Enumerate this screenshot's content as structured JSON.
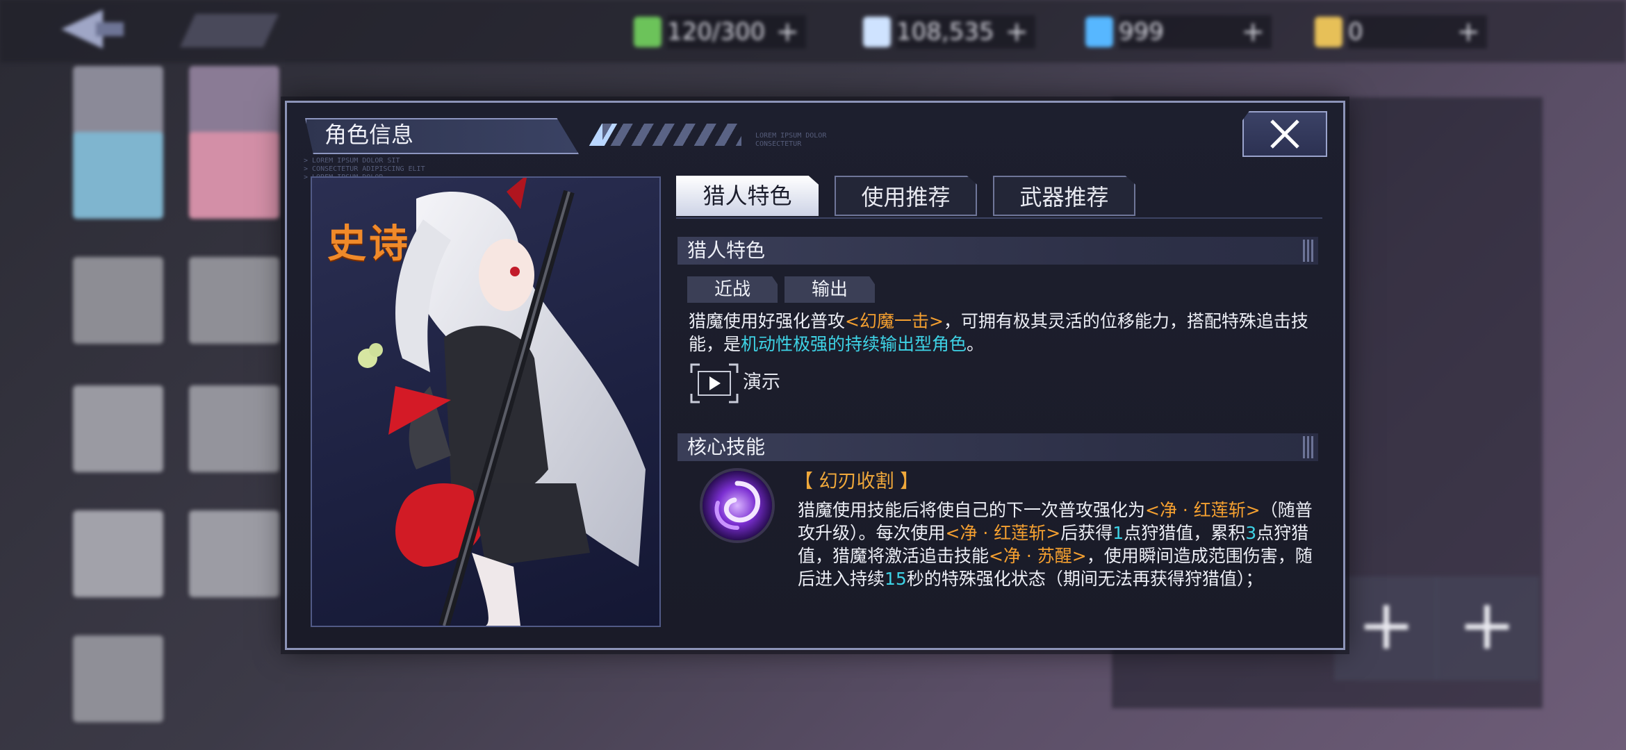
{
  "topbar": {
    "resources": [
      {
        "icon": "battery-icon",
        "value": "120/300",
        "color": "#6cc35a"
      },
      {
        "icon": "diamond-icon",
        "value": "108,535",
        "color": "#cfe3ff"
      },
      {
        "icon": "gem-icon",
        "value": "999",
        "color": "#57b7ff"
      },
      {
        "icon": "ticket-icon",
        "value": "0",
        "color": "#e7c058"
      }
    ]
  },
  "modal": {
    "title": "角色信息",
    "rarity": "史诗",
    "tiny_text_1": "LOREM IPSUM DOLOR\nCONSECTETUR",
    "tiny_text_2": "> LOREM IPSUM DOLOR SIT\n> CONSECTETUR ADIPISCING ELIT\n> LOREM IPSUM DOLOR",
    "tabs": [
      {
        "label": "猎人特色",
        "active": true
      },
      {
        "label": "使用推荐",
        "active": false
      },
      {
        "label": "武器推荐",
        "active": false
      }
    ],
    "trait_section": {
      "heading": "猎人特色",
      "tags": [
        "近战",
        "输出"
      ],
      "desc_part1": "猎魔使用好强化普攻",
      "desc_highlight1": "<幻魔一击>",
      "desc_part2": "，可拥有极其灵活的位移能力，搭配特殊追击技能，是",
      "desc_highlight2": "机动性极强的持续输出型角色",
      "desc_part3": "。",
      "demo_label": "演示"
    },
    "skill_section": {
      "heading": "核心技能",
      "skill_name": "【 幻刃收割 】",
      "d1": "猎魔使用技能后将使自己的下一次普攻强化为",
      "h1": "<净 · 红莲斩>",
      "d2": "（随普攻升级）。每次使用",
      "h2": "<净 · 红莲斩>",
      "d3": "后获得",
      "n1": "1",
      "d4": "点狩猎值，累积",
      "n2": "3",
      "d5": "点狩猎值，猎魔将激活追击技能",
      "h3": "<净 · 苏醒>",
      "d6": "，使用瞬间造成范围伤害，随后进入持续",
      "n3": "15",
      "d7": "秒的特殊强化状态（期间无法再获得狩猎值）；"
    }
  }
}
